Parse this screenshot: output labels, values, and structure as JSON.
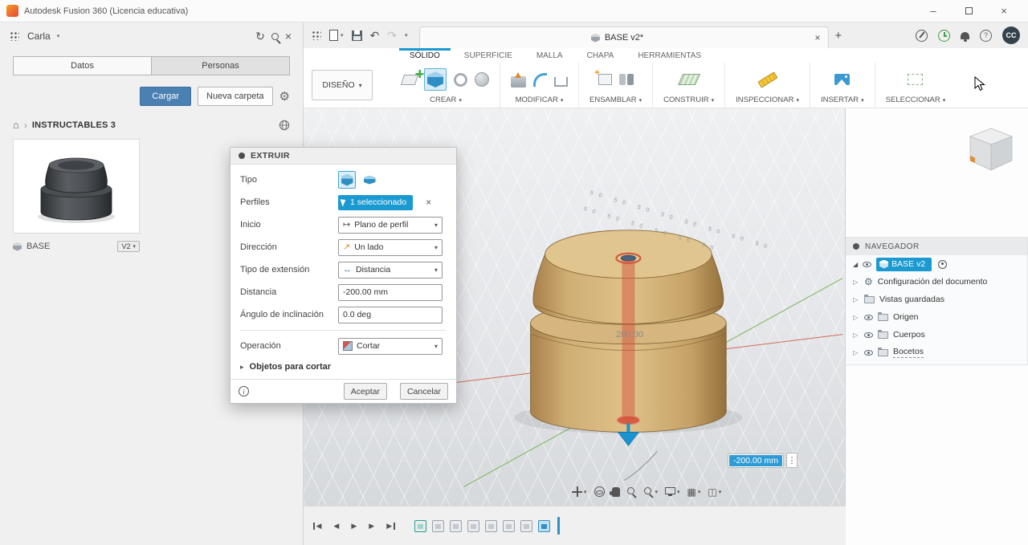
{
  "colors": {
    "accent_blue": "#1b9ad2",
    "upload_button_blue": "#4a80b2",
    "model_tan": "#d4b57c",
    "extrude_preview_red": "#d4543c",
    "viewport_gray": "#e4e6e9"
  },
  "icons": {
    "dropdown": "▾",
    "chevron": "›",
    "close": "×",
    "refresh": "↻",
    "undo": "↶",
    "redo": "↷",
    "minimize": "–",
    "help": "?",
    "gear": "⚙",
    "home": "⌂",
    "grid": "▦",
    "viewports": "◫",
    "kebab": "⋮",
    "play": "▶",
    "back": "◀",
    "branch": "▷",
    "expand": "▸",
    "corner": "◢",
    "info": "i",
    "plus": "+",
    "start": "↦",
    "direction": "↗",
    "extent": "↔"
  },
  "titlebar": {
    "app_title": "Autodesk Fusion 360 (Licencia educativa)"
  },
  "data_panel": {
    "user_name": "Carla",
    "tabs": [
      {
        "label": "Datos"
      },
      {
        "label": "Personas"
      }
    ],
    "upload_button": "Cargar",
    "new_folder_button": "Nueva carpeta",
    "project_name": "INSTRUCTABLES 3",
    "item": {
      "name": "BASE",
      "version": "V2"
    }
  },
  "document": {
    "tab_title": "BASE v2*"
  },
  "account": {
    "initials": "CC"
  },
  "ribbon": {
    "design_label": "DISEÑO",
    "tabs": [
      {
        "label": "SÓLIDO"
      },
      {
        "label": "SUPERFICIE"
      },
      {
        "label": "MALLA"
      },
      {
        "label": "CHAPA"
      },
      {
        "label": "HERRAMIENTAS"
      }
    ],
    "groups": [
      {
        "label": "CREAR"
      },
      {
        "label": "MODIFICAR"
      },
      {
        "label": "ENSAMBLAR"
      },
      {
        "label": "CONSTRUIR"
      },
      {
        "label": "INSPECCIONAR"
      },
      {
        "label": "INSERTAR"
      },
      {
        "label": "SELECCIONAR"
      }
    ]
  },
  "dialog": {
    "title": "EXTRUIR",
    "labels": {
      "tipo": "Tipo",
      "perfiles": "Perfiles",
      "inicio": "Inicio",
      "direccion": "Dirección",
      "extension": "Tipo de extensión",
      "distancia": "Distancia",
      "angulo": "Ángulo de inclinación",
      "operacion": "Operación"
    },
    "values": {
      "perfiles": "1 seleccionado",
      "inicio": "Plano de perfil",
      "direccion": "Un lado",
      "extension": "Distancia",
      "distancia": "-200.00 mm",
      "angulo": "0.0 deg",
      "operacion": "Cortar"
    },
    "objects_section": "Objetos para cortar",
    "accept_button": "Aceptar",
    "cancel_button": "Cancelar"
  },
  "viewport": {
    "dimension_label": "200.00",
    "manipulator_value": "-200.00 mm",
    "ruler_line1": "50  50  50  50  50  50  50  50",
    "ruler_line2": "50  50  50  50  50  50"
  },
  "navigator": {
    "title": "NAVEGADOR",
    "items": [
      {
        "label": "BASE v2"
      },
      {
        "label": "Configuración del documento"
      },
      {
        "label": "Vistas guardadas"
      },
      {
        "label": "Origen"
      },
      {
        "label": "Cuerpos"
      },
      {
        "label": "Bocetos"
      }
    ]
  }
}
